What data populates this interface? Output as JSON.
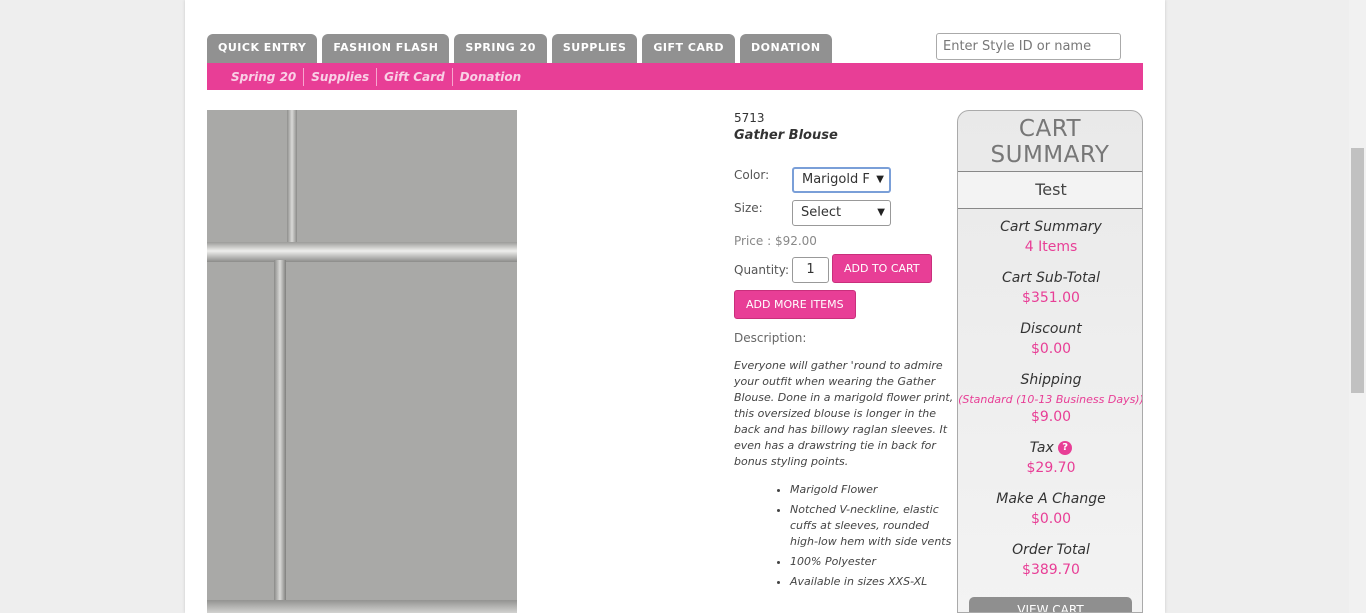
{
  "nav": {
    "tabs": [
      {
        "label": "QUICK ENTRY"
      },
      {
        "label": "FASHION FLASH"
      },
      {
        "label": "SPRING 20"
      },
      {
        "label": "SUPPLIES"
      },
      {
        "label": "GIFT CARD"
      },
      {
        "label": "DONATION"
      }
    ],
    "search_placeholder": "Enter Style ID or name",
    "subnav": [
      "Spring 20",
      "Supplies",
      "Gift Card",
      "Donation"
    ]
  },
  "product": {
    "style_id": "5713",
    "name": "Gather Blouse",
    "color_label": "Color:",
    "color_value": "Marigold F",
    "size_label": "Size:",
    "size_value": "Select",
    "price_text": "Price : $92.00",
    "quantity_label": "Quantity:",
    "quantity_value": "1",
    "add_to_cart": "ADD TO CART",
    "add_more_items": "ADD MORE ITEMS",
    "description_label": "Description:",
    "description": "Everyone will gather 'round to admire your outfit when wearing the Gather Blouse. Done in a marigold flower print, this oversized blouse is longer in the back and has billowy raglan sleeves. It even has a drawstring tie in back for bonus styling points.",
    "bullets": [
      "Marigold Flower",
      "Notched V-neckline, elastic cuffs at sleeves, rounded high-low hem with side vents",
      "100% Polyester",
      "Available in sizes XXS-XL"
    ]
  },
  "cart": {
    "title": "CART SUMMARY",
    "user": "Test",
    "summary_label": "Cart Summary",
    "items": "4 Items",
    "subtotal_label": "Cart Sub-Total",
    "subtotal": "$351.00",
    "discount_label": "Discount",
    "discount": "$0.00",
    "shipping_label": "Shipping",
    "shipping_method": "(Standard (10-13 Business Days))",
    "shipping": "$9.00",
    "tax_label": "Tax",
    "tax_help": "?",
    "tax": "$29.70",
    "change_label": "Make A Change",
    "change": "$0.00",
    "total_label": "Order Total",
    "total": "$389.70",
    "view_cart": "VIEW CART"
  },
  "colors": {
    "accent": "#e83e96",
    "tab_gray": "#919191"
  }
}
